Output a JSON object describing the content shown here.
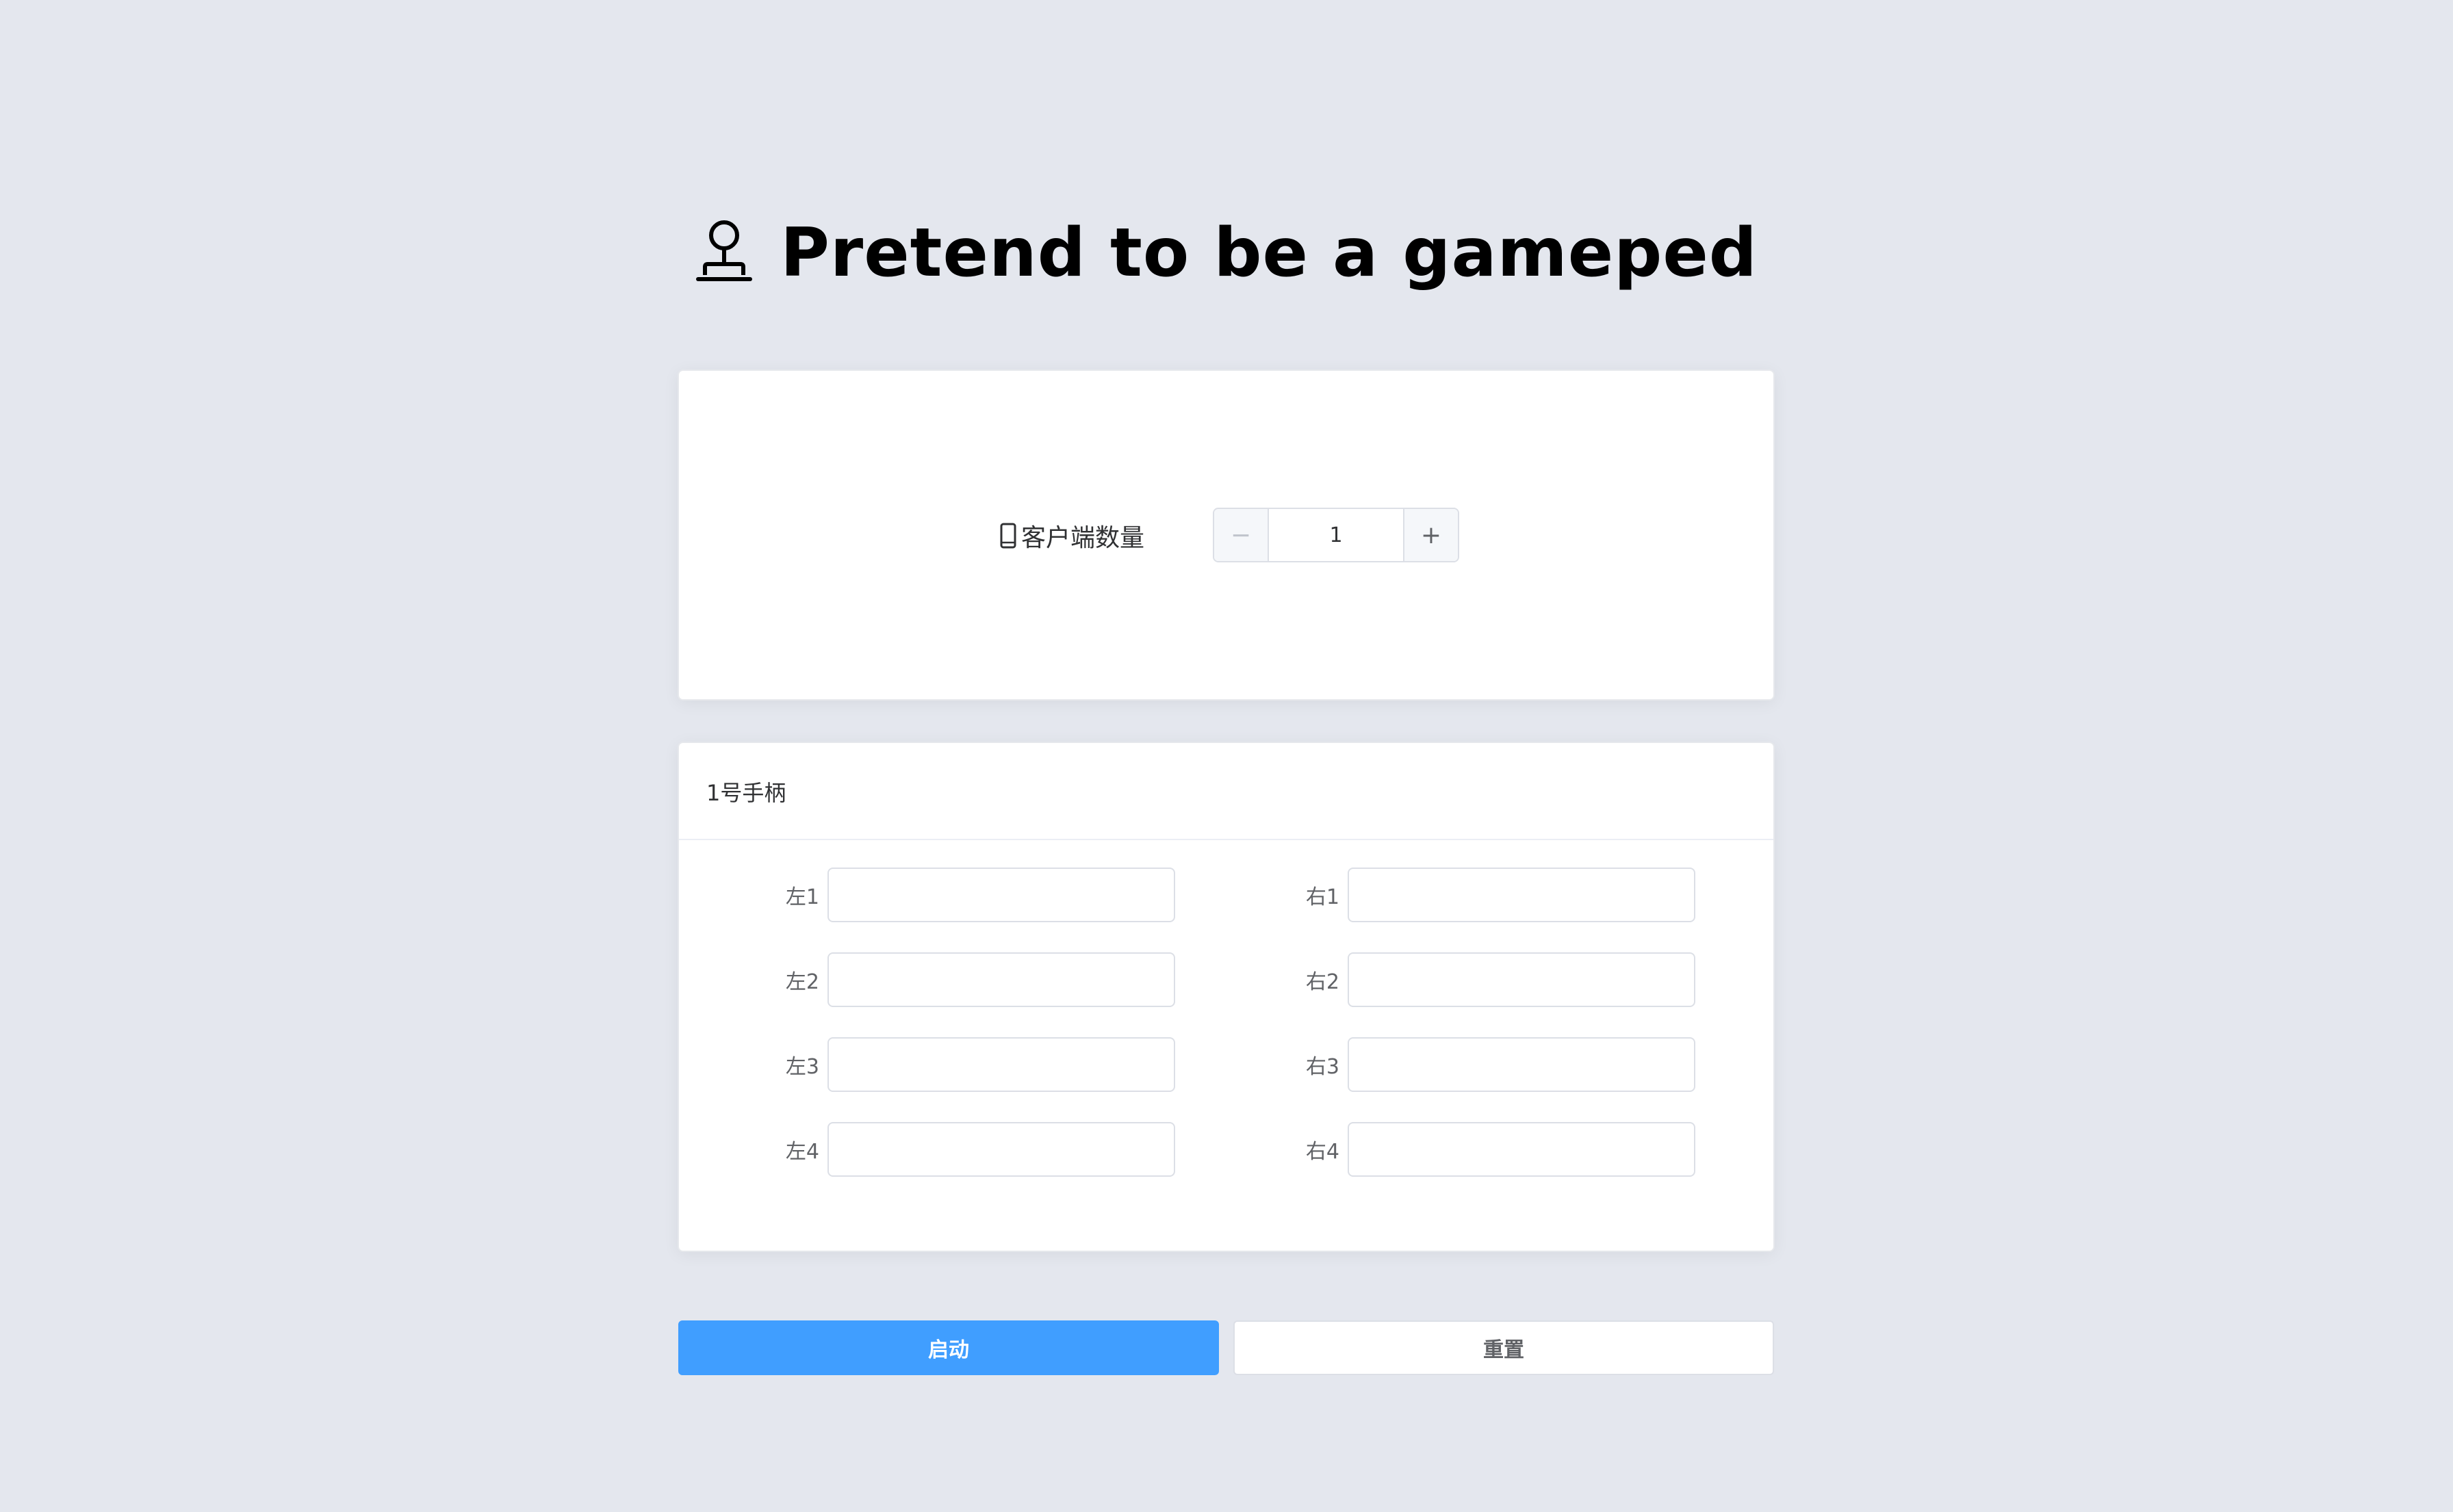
{
  "header": {
    "title": "Pretend to be a gameped",
    "icon": "joystick-icon"
  },
  "client_count": {
    "icon": "phone-icon",
    "label": "客户端数量",
    "value": "1",
    "decrement_label": "−",
    "increment_label": "+"
  },
  "gamepad": {
    "title": "1号手柄",
    "left_fields": [
      {
        "label": "左1",
        "value": ""
      },
      {
        "label": "左2",
        "value": ""
      },
      {
        "label": "左3",
        "value": ""
      },
      {
        "label": "左4",
        "value": ""
      }
    ],
    "right_fields": [
      {
        "label": "右1",
        "value": ""
      },
      {
        "label": "右2",
        "value": ""
      },
      {
        "label": "右3",
        "value": ""
      },
      {
        "label": "右4",
        "value": ""
      }
    ]
  },
  "actions": {
    "start_label": "启动",
    "reset_label": "重置"
  },
  "colors": {
    "background": "#e4e7ee",
    "primary": "#409eff",
    "card": "#ffffff"
  }
}
